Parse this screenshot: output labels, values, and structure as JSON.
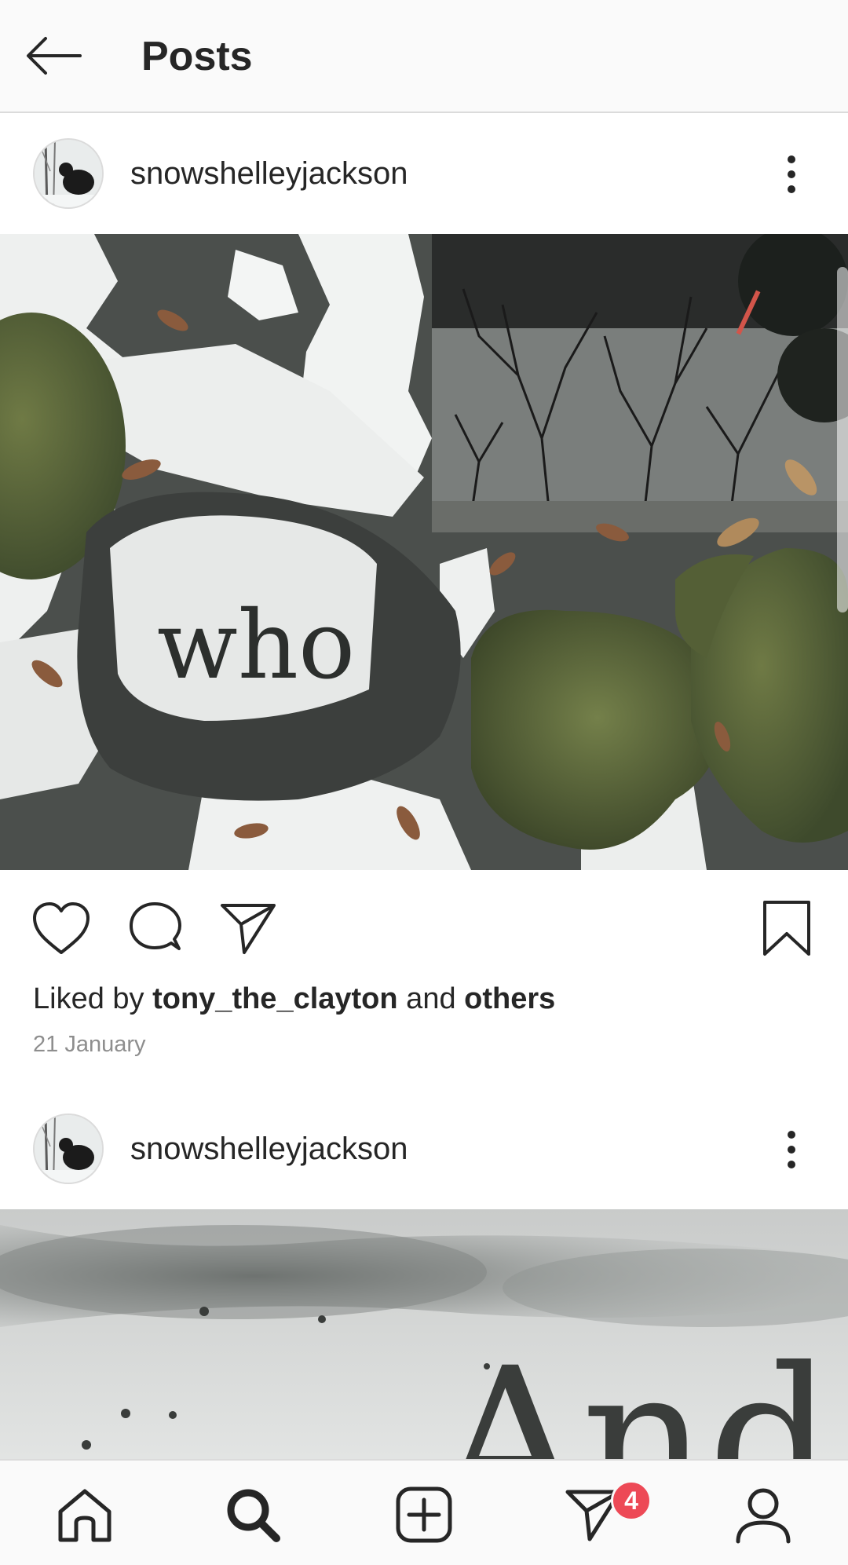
{
  "header": {
    "title": "Posts",
    "back_icon": "arrow-left-icon"
  },
  "posts": [
    {
      "username": "snowshelleyjackson",
      "image_text": "who",
      "liked_by_prefix": "Liked by ",
      "liked_by_user": "tony_the_clayton",
      "liked_by_and": " and ",
      "liked_by_others": "others",
      "date": "21 January"
    },
    {
      "username": "snowshelleyjackson",
      "image_text": "And"
    }
  ],
  "actions": {
    "like_icon": "heart-icon",
    "comment_icon": "comment-icon",
    "share_icon": "paper-plane-icon",
    "save_icon": "bookmark-icon"
  },
  "bottom_nav": {
    "items": [
      "home-icon",
      "search-icon",
      "add-post-icon",
      "direct-messages-icon",
      "profile-icon"
    ],
    "messages_badge": "4"
  },
  "colors": {
    "badge": "#ed4956",
    "text": "#262626",
    "muted": "#8e8e8e",
    "bar_background": "#fafafa"
  }
}
